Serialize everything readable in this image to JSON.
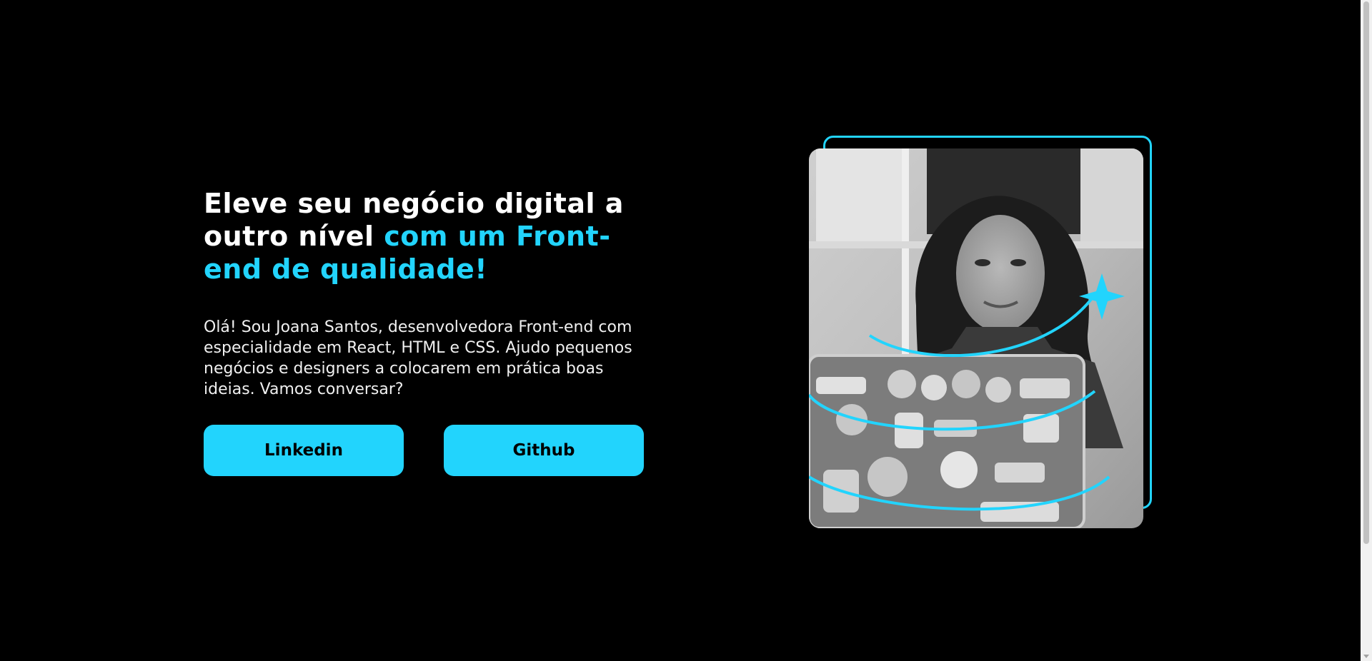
{
  "hero": {
    "title_line_plain": "Eleve seu negócio digital a outro nível ",
    "title_line_accent": "com um Front-end de qualidade!",
    "description": "Olá! Sou Joana Santos, desenvolvedora Front-end com especialidade em React, HTML e CSS. Ajudo pequenos negócios e designers a colocarem em prática boas ideias. Vamos conversar?",
    "buttons": {
      "linkedin_label": "Linkedin",
      "github_label": "Github"
    }
  },
  "colors": {
    "background": "#000000",
    "accent": "#22d4fd",
    "text": "#ffffff",
    "button_text": "#000000"
  },
  "icons": {
    "decorative_sparkle": "sparkle-icon"
  }
}
